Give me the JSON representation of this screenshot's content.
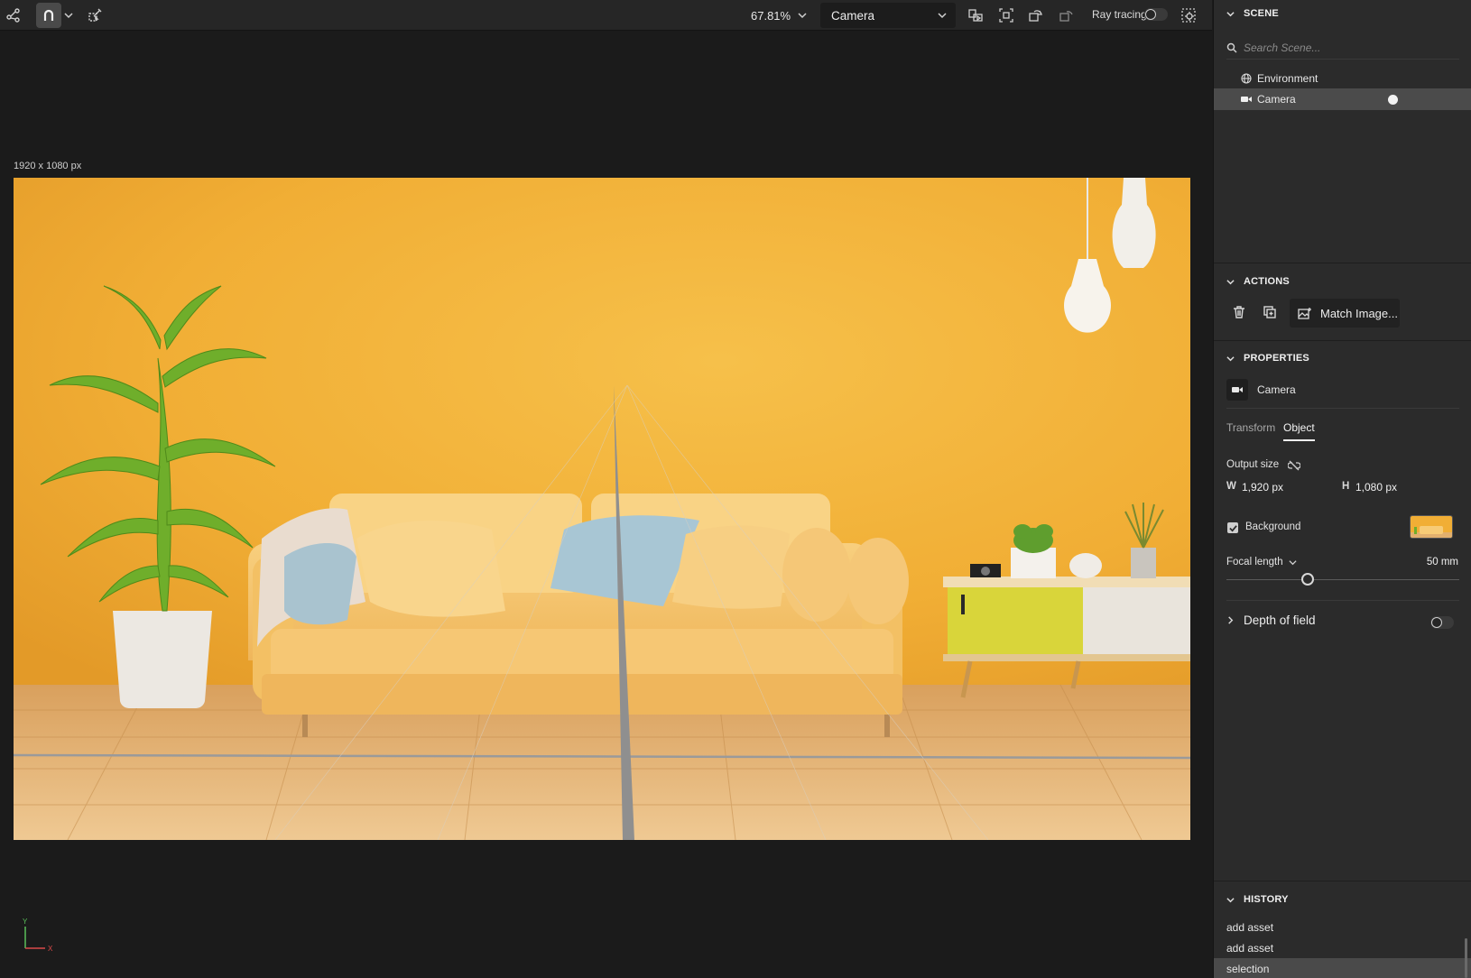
{
  "toolbar": {
    "zoom": "67.81%",
    "camera": "Camera",
    "raytracing_label": "Ray tracing",
    "raytracing_on": false
  },
  "viewport": {
    "canvas_size": "1920 x 1080 px",
    "axis_y": "Y",
    "axis_x": "X"
  },
  "scene": {
    "title": "SCENE",
    "search_placeholder": "Search Scene...",
    "items": [
      {
        "label": "Environment",
        "icon": "globe-icon"
      },
      {
        "label": "Camera",
        "icon": "video-camera-icon",
        "selected": true
      }
    ]
  },
  "actions": {
    "title": "ACTIONS",
    "match_image": "Match Image..."
  },
  "properties": {
    "title": "PROPERTIES",
    "target": "Camera",
    "tabs": [
      "Transform",
      "Object"
    ],
    "active_tab": "Object",
    "output_size_label": "Output size",
    "w_label": "W",
    "w_value": "1,920 px",
    "h_label": "H",
    "h_value": "1,080 px",
    "background_label": "Background",
    "background_checked": true,
    "focal_label": "Focal length",
    "focal_value": "50 mm",
    "focal_fraction": 0.35,
    "dof_label": "Depth of field",
    "dof_on": false
  },
  "history": {
    "title": "HISTORY",
    "items": [
      "add asset",
      "add asset",
      "selection"
    ]
  },
  "colors": {
    "panel_bg": "#2b2b2b",
    "viewport_bg": "#1b1b1b",
    "selection": "#4b4b4b",
    "wall": "#f3b13a",
    "floor": "#e2b06e"
  }
}
